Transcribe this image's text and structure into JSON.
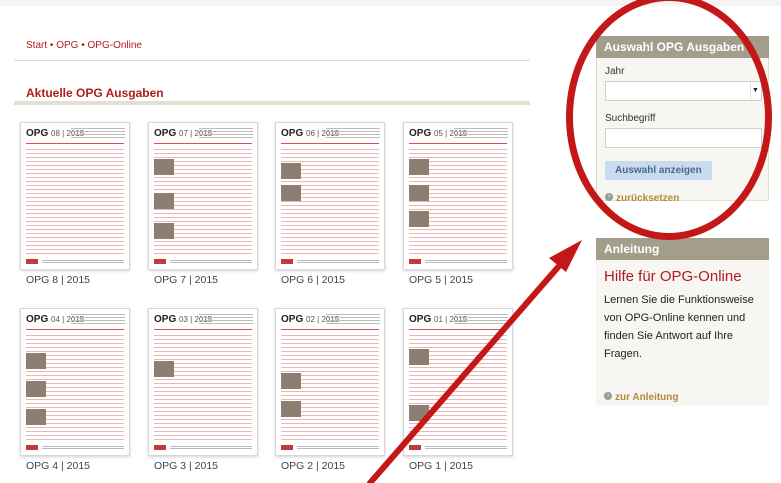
{
  "breadcrumb": {
    "items": [
      "Start",
      "OPG",
      "OPG-Online"
    ],
    "separator": "•"
  },
  "section_title": "Aktuelle OPG Ausgaben",
  "issues": [
    {
      "logo": "OPG",
      "issue": "08 | 2015",
      "label": "OPG 8 | 2015"
    },
    {
      "logo": "OPG",
      "issue": "07 | 2015",
      "label": "OPG 7 | 2015"
    },
    {
      "logo": "OPG",
      "issue": "06 | 2015",
      "label": "OPG 6 | 2015"
    },
    {
      "logo": "OPG",
      "issue": "05 | 2015",
      "label": "OPG 5 | 2015"
    },
    {
      "logo": "OPG",
      "issue": "04 | 2015",
      "label": "OPG 4 | 2015"
    },
    {
      "logo": "OPG",
      "issue": "03 | 2015",
      "label": "OPG 3 | 2015"
    },
    {
      "logo": "OPG",
      "issue": "02 | 2015",
      "label": "OPG 2 | 2015"
    },
    {
      "logo": "OPG",
      "issue": "01 | 2015",
      "label": "OPG 1 | 2015"
    }
  ],
  "filter_panel": {
    "title": "Auswahl OPG Ausgaben",
    "year_label": "Jahr",
    "year_value": "",
    "search_label": "Suchbegriff",
    "search_value": "",
    "submit_label": "Auswahl anzeigen",
    "reset_label": "zurücksetzen"
  },
  "help_panel": {
    "title": "Anleitung",
    "heading": "Hilfe für OPG-Online",
    "text": "Lernen Sie die Funktionsweise von OPG-Online kennen und finden Sie Antwort auf Ihre Fragen.",
    "link_label": "zur Anleitung"
  },
  "icons": {
    "link_bullet": "circle-arrow-icon",
    "select_arrow": "chevron-down-icon"
  },
  "colors": {
    "accent_red": "#b01c1c",
    "panel_header": "#a39d8c",
    "annotation_red": "#c41717",
    "button_bg": "#c9dcee"
  }
}
